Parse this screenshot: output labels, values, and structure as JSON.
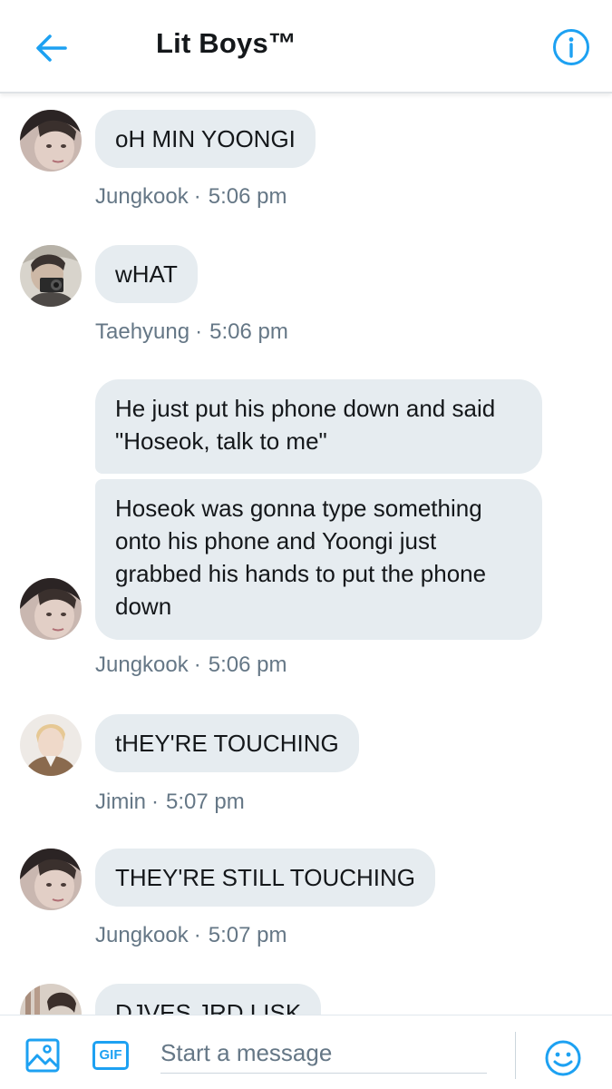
{
  "header": {
    "title": "Lit Boys™"
  },
  "colors": {
    "accent": "#1da1f2",
    "bubble": "#e6ecf0",
    "meta_text": "#657786"
  },
  "messages": [
    {
      "sender": "Jungkook",
      "time": "5:06 pm",
      "texts": [
        "oH MIN YOONGI"
      ]
    },
    {
      "sender": "Taehyung",
      "time": "5:06 pm",
      "texts": [
        "wHAT"
      ]
    },
    {
      "sender": "Jungkook",
      "time": "5:06 pm",
      "texts": [
        "He just put his phone down and said \"Hoseok, talk to me\"",
        "Hoseok was gonna type something onto his phone and Yoongi just grabbed his hands to put the phone down"
      ]
    },
    {
      "sender": "Jimin",
      "time": "5:07 pm",
      "texts": [
        "tHEY'RE TOUCHING"
      ]
    },
    {
      "sender": "Jungkook",
      "time": "5:07 pm",
      "texts": [
        "THEY'RE STILL TOUCHING"
      ]
    },
    {
      "sender": "",
      "time": "",
      "texts": [
        "DJVES JRD LISK"
      ]
    }
  ],
  "composer": {
    "placeholder": "Start a message",
    "gif_label": "GIF"
  },
  "icons": {
    "back": "arrow-left-icon",
    "info": "info-icon",
    "image": "image-icon",
    "gif": "gif-icon",
    "emoji": "emoji-icon"
  }
}
